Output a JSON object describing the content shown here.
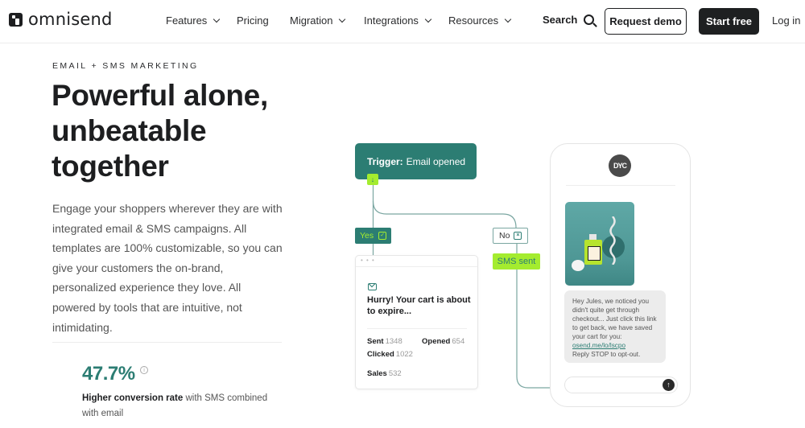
{
  "nav": {
    "brand": "omnisend",
    "items": [
      {
        "label": "Features",
        "has_dropdown": true
      },
      {
        "label": "Pricing",
        "has_dropdown": false
      },
      {
        "label": "Migration",
        "has_dropdown": true
      },
      {
        "label": "Integrations",
        "has_dropdown": true
      },
      {
        "label": "Resources",
        "has_dropdown": true
      }
    ],
    "search_label": "Search",
    "request_demo_label": "Request demo",
    "start_free_label": "Start free",
    "login_label": "Log in"
  },
  "hero": {
    "eyebrow": "EMAIL + SMS MARKETING",
    "headline_line1": "Powerful alone,",
    "headline_line2": "unbeatable",
    "headline_line3": "together",
    "body": "Engage your shoppers wherever they are with integrated email & SMS campaigns. All templates are 100% customizable, so you can give your customers the on-brand, personalized experience they love. All powered by tools that are intuitive, not intimidating.",
    "stat_value": "47.7%",
    "stat_info_icon": "info-icon",
    "stat_desc_bold": "Higher conversion rate",
    "stat_desc_rest": " with SMS combined with email"
  },
  "flow": {
    "trigger_label": "Trigger:",
    "trigger_value": "Email opened",
    "yes_label": "Yes",
    "no_label": "No",
    "sms_sent_label": "SMS sent",
    "email_card": {
      "dots": "• • •",
      "subject": "Hurry! Your cart is about to expire...",
      "metrics": [
        {
          "label": "Sent",
          "value": "1348"
        },
        {
          "label": "Opened",
          "value": "654"
        },
        {
          "label": "Clicked",
          "value": "1022"
        },
        {
          "label": "Sales",
          "value": "532"
        }
      ]
    }
  },
  "phone": {
    "avatar_text": "DYC",
    "sms_text": "Hey Jules, we noticed you didn't quite get through checkout... Just click this link to get back, we have saved your cart for you:",
    "sms_link": "osend.me/lo/lscpo",
    "sms_optout": "Reply STOP to opt-out."
  },
  "colors": {
    "brand_teal": "#2c7d73",
    "accent_lime": "#a4ec2f",
    "dark": "#1e2021"
  }
}
